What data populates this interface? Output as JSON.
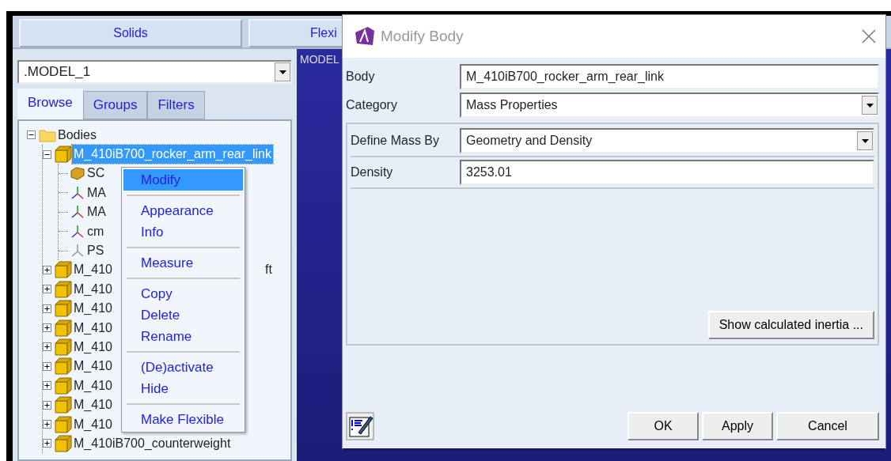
{
  "top_tabs": [
    {
      "label": "Solids"
    },
    {
      "label": "Flexi"
    }
  ],
  "model_selector": {
    "value": ".MODEL_1"
  },
  "panel_tabs": [
    {
      "label": "Browse",
      "selected": true
    },
    {
      "label": "Groups",
      "selected": false
    },
    {
      "label": "Filters",
      "selected": false
    }
  ],
  "tree": [
    {
      "label": "Bodies",
      "kind": "folder",
      "expanded": true,
      "selected": false,
      "children": [
        {
          "label": "M_410iB700_rocker_arm_rear_link",
          "kind": "body",
          "expanded": true,
          "selected": true,
          "children": [
            {
              "label": "SC",
              "kind": "solid",
              "selected": false
            },
            {
              "label": "MA",
              "kind": "frame",
              "selected": false
            },
            {
              "label": "MA",
              "kind": "frame",
              "selected": false
            },
            {
              "label": "cm",
              "kind": "frame",
              "selected": false
            },
            {
              "label": "PS",
              "kind": "point",
              "selected": false
            }
          ]
        },
        {
          "label": "M_410",
          "tail": "ft",
          "kind": "body",
          "expanded": false,
          "selected": false
        },
        {
          "label": "M_410",
          "kind": "body",
          "expanded": false,
          "selected": false
        },
        {
          "label": "M_410",
          "kind": "body",
          "expanded": false,
          "selected": false
        },
        {
          "label": "M_410",
          "kind": "body",
          "expanded": false,
          "selected": false
        },
        {
          "label": "M_410",
          "kind": "body",
          "expanded": false,
          "selected": false
        },
        {
          "label": "M_410",
          "kind": "body",
          "expanded": false,
          "selected": false
        },
        {
          "label": "M_410",
          "kind": "body",
          "expanded": false,
          "selected": false
        },
        {
          "label": "M_410",
          "kind": "body",
          "expanded": false,
          "selected": false
        },
        {
          "label": "M_410",
          "kind": "body",
          "expanded": false,
          "selected": false
        },
        {
          "label": "M_410iB700_counterweight",
          "kind": "body",
          "expanded": false,
          "selected": false
        }
      ]
    }
  ],
  "viewport": {
    "label": "MODEL"
  },
  "context_menu": {
    "groups": [
      [
        {
          "label": "Modify",
          "selected": true
        }
      ],
      [
        {
          "label": "Appearance",
          "selected": false
        },
        {
          "label": "Info",
          "selected": false
        }
      ],
      [
        {
          "label": "Measure",
          "selected": false
        }
      ],
      [
        {
          "label": "Copy",
          "selected": false
        },
        {
          "label": "Delete",
          "selected": false
        },
        {
          "label": "Rename",
          "selected": false
        }
      ],
      [
        {
          "label": "(De)activate",
          "selected": false
        },
        {
          "label": "Hide",
          "selected": false
        }
      ],
      [
        {
          "label": "Make Flexible",
          "selected": false
        }
      ]
    ]
  },
  "dialog": {
    "title": "Modify Body",
    "fields": [
      {
        "label": "Body",
        "kind": "text",
        "value": "M_410iB700_rocker_arm_rear_link"
      },
      {
        "label": "Category",
        "kind": "select",
        "value": "Mass Properties"
      }
    ],
    "group_fields": [
      {
        "label": "Define Mass By",
        "kind": "select",
        "value": "Geometry and Density"
      },
      {
        "label": "Density",
        "kind": "text",
        "value": "3253.01"
      }
    ],
    "group_button": "Show calculated inertia ...",
    "buttons": [
      "OK",
      "Apply",
      "Cancel"
    ]
  }
}
